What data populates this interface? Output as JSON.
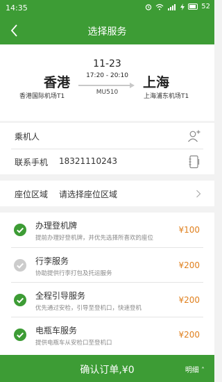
{
  "status": {
    "time": "14:35",
    "battery": "52"
  },
  "nav": {
    "title": "选择服务"
  },
  "flight": {
    "date": "11-23",
    "times": "17:20 - 20:10",
    "number": "MU510",
    "dep_city": "香港",
    "dep_airport": "香港国际机场T1",
    "arr_city": "上海",
    "arr_airport": "上海浦东机场T1"
  },
  "passenger": {
    "label": "乘机人"
  },
  "contact": {
    "label": "联系手机",
    "value": "18321110243"
  },
  "seat": {
    "label": "座位区域",
    "value": "请选择座位区域"
  },
  "services": [
    {
      "name": "办理登机牌",
      "desc": "提前办理好登机牌，并优先选择所喜欢的座位",
      "price": "¥100",
      "checked": true
    },
    {
      "name": "行李服务",
      "desc": "协助提供行李打包及托运服务",
      "price": "¥200",
      "checked": false
    },
    {
      "name": "全程引导服务",
      "desc": "优先通过安检，引导至登机口，快速登机",
      "price": "¥200",
      "checked": true
    },
    {
      "name": "电瓶车服务",
      "desc": "提供电瓶车从安检口至登机口",
      "price": "¥200",
      "checked": true
    }
  ],
  "footer": {
    "confirm_label": "确认订单,¥0",
    "detail_label": "明细 ˄"
  },
  "colors": {
    "primary": "#3d9c35",
    "price": "#e0801e",
    "unchecked": "#cccccc"
  }
}
